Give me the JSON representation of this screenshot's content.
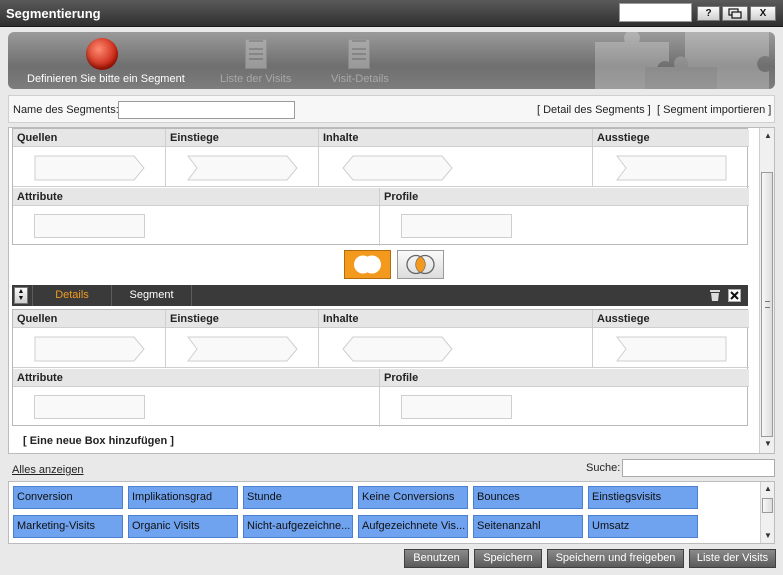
{
  "window": {
    "title": "Segmentierung",
    "buttons": {
      "help": "?",
      "chat": "▢",
      "close": "X"
    }
  },
  "wizard": {
    "steps": [
      {
        "label": "Definieren Sie bitte ein Segment",
        "active": true
      },
      {
        "label": "Liste der Visits",
        "active": false
      },
      {
        "label": "Visit-Details",
        "active": false
      }
    ]
  },
  "name_row": {
    "label": "Name des Segments:",
    "value": "",
    "links": [
      "[ Detail des Segments ]",
      "[ Segment importieren ]"
    ]
  },
  "segment_columns": {
    "row1": [
      "Quellen",
      "Einstiege",
      "Inhalte",
      "Ausstiege"
    ],
    "row2": [
      "Attribute",
      "Profile"
    ]
  },
  "segment_toolbar": {
    "tabs": [
      "Details",
      "Segment"
    ],
    "active_tab": "Details"
  },
  "add_box": "[ Eine neue Box hinzufügen ]",
  "bottom": {
    "show_all": "Alles anzeigen",
    "search_label": "Suche:",
    "search_value": "",
    "tiles": [
      "Conversion",
      "Implikationsgrad",
      "Stunde",
      "Keine Conversions",
      "Bounces",
      "Einstiegsvisits",
      "Marketing-Visits",
      "Organic Visits",
      "Nicht-aufgezeichne...",
      "Aufgezeichnete Vis...",
      "Seitenanzahl",
      "Umsatz"
    ]
  },
  "footer": {
    "buttons": [
      "Benutzen",
      "Speichern",
      "Speichern und freigeben",
      "Liste der Visits"
    ]
  },
  "colors": {
    "titlebar": "#3a3a3a",
    "active_tab": "#f39a1e",
    "tile": "#6fa2ef",
    "button": "#6a6a6a"
  }
}
